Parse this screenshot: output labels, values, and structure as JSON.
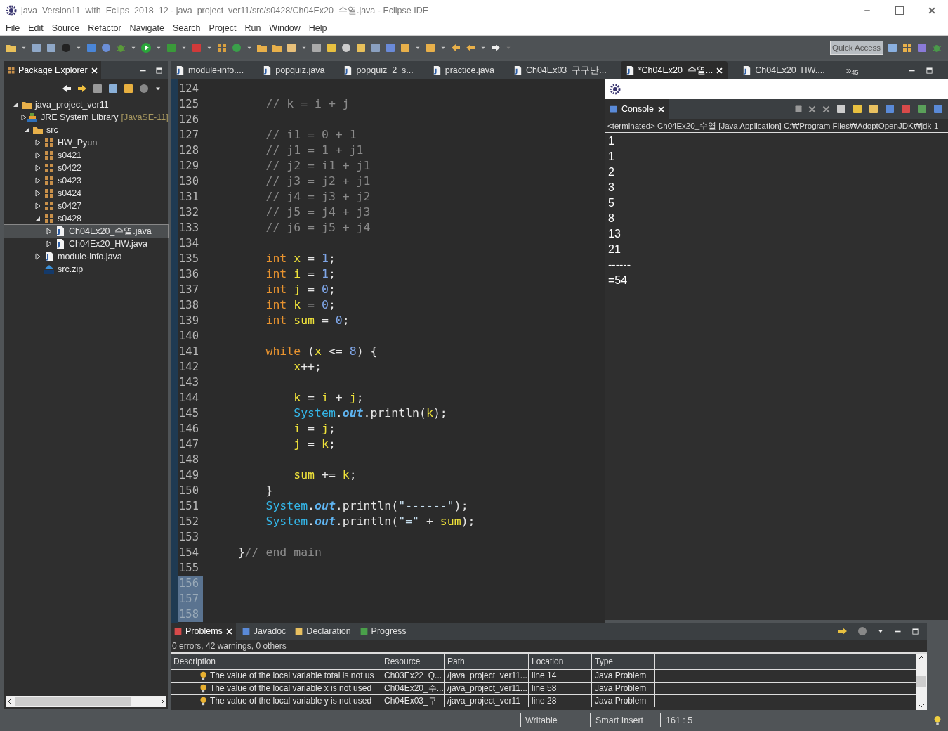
{
  "window": {
    "title": "java_Version11_with_Eclips_2018_12 - java_project_ver11/src/s0428/Ch04Ex20_수열.java - Eclipse IDE"
  },
  "menu": [
    "File",
    "Edit",
    "Source",
    "Refactor",
    "Navigate",
    "Search",
    "Project",
    "Run",
    "Window",
    "Help"
  ],
  "quick_access": {
    "placeholder": "Quick Access"
  },
  "package_explorer": {
    "title": "Package Explorer",
    "tree": [
      {
        "label": "java_project_ver11",
        "kind": "project",
        "expanded": true,
        "selected": false,
        "children": [
          {
            "label": "JRE System Library",
            "qualifier": "[JavaSE-11]",
            "kind": "library",
            "expanded": false,
            "selected": false
          },
          {
            "label": "src",
            "kind": "source-folder",
            "expanded": true,
            "selected": false,
            "children": [
              {
                "label": "HW_Pyun",
                "kind": "package",
                "expanded": false,
                "selected": false
              },
              {
                "label": "s0421",
                "kind": "package",
                "expanded": false,
                "selected": false
              },
              {
                "label": "s0422",
                "kind": "package",
                "expanded": false,
                "selected": false
              },
              {
                "label": "s0423",
                "kind": "package",
                "expanded": false,
                "selected": false
              },
              {
                "label": "s0424",
                "kind": "package",
                "expanded": false,
                "selected": false
              },
              {
                "label": "s0427",
                "kind": "package",
                "expanded": false,
                "selected": false
              },
              {
                "label": "s0428",
                "kind": "package",
                "expanded": true,
                "selected": false,
                "children": [
                  {
                    "label": "Ch04Ex20_수열.java",
                    "kind": "java-file",
                    "expanded": false,
                    "selected": true
                  },
                  {
                    "label": "Ch04Ex20_HW.java",
                    "kind": "java-file",
                    "expanded": false,
                    "selected": false
                  }
                ]
              },
              {
                "label": "module-info.java",
                "kind": "java-file",
                "expanded": false,
                "selected": false
              },
              {
                "label": "src.zip",
                "kind": "zip",
                "selected": false
              }
            ]
          }
        ]
      }
    ]
  },
  "editor_tabs": [
    {
      "label": "module-info....",
      "selected": false
    },
    {
      "label": "popquiz.java",
      "selected": false
    },
    {
      "label": "popquiz_2_s...",
      "selected": false
    },
    {
      "label": "practice.java",
      "selected": false
    },
    {
      "label": "Ch04Ex03_구구단...",
      "selected": false
    },
    {
      "label": "*Ch04Ex20_수열...",
      "selected": true
    },
    {
      "label": "Ch04Ex20_HW....",
      "selected": false
    }
  ],
  "overflow": {
    "chevron": "»",
    "count": "45"
  },
  "code_lines": [
    {
      "number": "124",
      "selected": false
    },
    {
      "number": "125",
      "selected": false,
      "tokens": [
        {
          "kind": "comment",
          "text": "        // k = i + j"
        }
      ]
    },
    {
      "number": "126",
      "selected": false
    },
    {
      "number": "127",
      "selected": false,
      "tokens": [
        {
          "kind": "comment",
          "text": "        // i1 = 0 + 1"
        }
      ]
    },
    {
      "number": "128",
      "selected": false,
      "tokens": [
        {
          "kind": "comment",
          "text": "        // j1 = 1 + j1"
        }
      ]
    },
    {
      "number": "129",
      "selected": false,
      "tokens": [
        {
          "kind": "comment",
          "text": "        // j2 = i1 + j1"
        }
      ]
    },
    {
      "number": "130",
      "selected": false,
      "tokens": [
        {
          "kind": "comment",
          "text": "        // j3 = j2 + j1"
        }
      ]
    },
    {
      "number": "131",
      "selected": false,
      "tokens": [
        {
          "kind": "comment",
          "text": "        // j4 = j3 + j2"
        }
      ]
    },
    {
      "number": "132",
      "selected": false,
      "tokens": [
        {
          "kind": "comment",
          "text": "        // j5 = j4 + j3"
        }
      ]
    },
    {
      "number": "133",
      "selected": false,
      "tokens": [
        {
          "kind": "comment",
          "text": "        // j6 = j5 + j4"
        }
      ]
    },
    {
      "number": "134",
      "selected": false
    },
    {
      "number": "135",
      "selected": false,
      "tokens": [
        {
          "kind": "keyword",
          "text": "        int "
        },
        {
          "kind": "variable",
          "text": "x"
        },
        {
          "kind": "plain",
          "text": " = "
        },
        {
          "kind": "number",
          "text": "1"
        },
        {
          "kind": "plain",
          "text": ";"
        }
      ]
    },
    {
      "number": "136",
      "selected": false,
      "tokens": [
        {
          "kind": "keyword",
          "text": "        int "
        },
        {
          "kind": "variable",
          "text": "i"
        },
        {
          "kind": "plain",
          "text": " = "
        },
        {
          "kind": "number",
          "text": "1"
        },
        {
          "kind": "plain",
          "text": ";"
        }
      ]
    },
    {
      "number": "137",
      "selected": false,
      "tokens": [
        {
          "kind": "keyword",
          "text": "        int "
        },
        {
          "kind": "variable",
          "text": "j"
        },
        {
          "kind": "plain",
          "text": " = "
        },
        {
          "kind": "number",
          "text": "0"
        },
        {
          "kind": "plain",
          "text": ";"
        }
      ]
    },
    {
      "number": "138",
      "selected": false,
      "tokens": [
        {
          "kind": "keyword",
          "text": "        int "
        },
        {
          "kind": "variable",
          "text": "k"
        },
        {
          "kind": "plain",
          "text": " = "
        },
        {
          "kind": "number",
          "text": "0"
        },
        {
          "kind": "plain",
          "text": ";"
        }
      ]
    },
    {
      "number": "139",
      "selected": false,
      "tokens": [
        {
          "kind": "keyword",
          "text": "        int "
        },
        {
          "kind": "variable",
          "text": "sum"
        },
        {
          "kind": "plain",
          "text": " = "
        },
        {
          "kind": "number",
          "text": "0"
        },
        {
          "kind": "plain",
          "text": ";"
        }
      ]
    },
    {
      "number": "140",
      "selected": false
    },
    {
      "number": "141",
      "selected": false,
      "tokens": [
        {
          "kind": "keyword",
          "text": "        while"
        },
        {
          "kind": "plain",
          "text": " ("
        },
        {
          "kind": "variable",
          "text": "x"
        },
        {
          "kind": "plain",
          "text": " <= "
        },
        {
          "kind": "number",
          "text": "8"
        },
        {
          "kind": "plain",
          "text": ") {"
        }
      ]
    },
    {
      "number": "142",
      "selected": false,
      "tokens": [
        {
          "kind": "variable",
          "text": "            x"
        },
        {
          "kind": "plain",
          "text": "++;"
        }
      ]
    },
    {
      "number": "143",
      "selected": false
    },
    {
      "number": "144",
      "selected": false,
      "tokens": [
        {
          "kind": "variable",
          "text": "            k"
        },
        {
          "kind": "plain",
          "text": " = "
        },
        {
          "kind": "variable",
          "text": "i"
        },
        {
          "kind": "plain",
          "text": " + "
        },
        {
          "kind": "variable",
          "text": "j"
        },
        {
          "kind": "plain",
          "text": ";"
        }
      ]
    },
    {
      "number": "145",
      "selected": false,
      "tokens": [
        {
          "kind": "type",
          "text": "            System"
        },
        {
          "kind": "plain",
          "text": "."
        },
        {
          "kind": "field",
          "text": "out"
        },
        {
          "kind": "plain",
          "text": ".println("
        },
        {
          "kind": "variable",
          "text": "k"
        },
        {
          "kind": "plain",
          "text": ");"
        }
      ]
    },
    {
      "number": "146",
      "selected": false,
      "tokens": [
        {
          "kind": "variable",
          "text": "            i"
        },
        {
          "kind": "plain",
          "text": " = "
        },
        {
          "kind": "variable",
          "text": "j"
        },
        {
          "kind": "plain",
          "text": ";"
        }
      ]
    },
    {
      "number": "147",
      "selected": false,
      "tokens": [
        {
          "kind": "variable",
          "text": "            j"
        },
        {
          "kind": "plain",
          "text": " = "
        },
        {
          "kind": "variable",
          "text": "k"
        },
        {
          "kind": "plain",
          "text": ";"
        }
      ]
    },
    {
      "number": "148",
      "selected": false
    },
    {
      "number": "149",
      "selected": false,
      "tokens": [
        {
          "kind": "variable",
          "text": "            sum"
        },
        {
          "kind": "plain",
          "text": " += "
        },
        {
          "kind": "variable",
          "text": "k"
        },
        {
          "kind": "plain",
          "text": ";"
        }
      ]
    },
    {
      "number": "150",
      "selected": false,
      "tokens": [
        {
          "kind": "plain",
          "text": "        }"
        }
      ]
    },
    {
      "number": "151",
      "selected": false,
      "tokens": [
        {
          "kind": "type",
          "text": "        System"
        },
        {
          "kind": "plain",
          "text": "."
        },
        {
          "kind": "field",
          "text": "out"
        },
        {
          "kind": "plain",
          "text": ".println("
        },
        {
          "kind": "string",
          "text": "\"------\""
        },
        {
          "kind": "plain",
          "text": ");"
        }
      ]
    },
    {
      "number": "152",
      "selected": false,
      "tokens": [
        {
          "kind": "type",
          "text": "        System"
        },
        {
          "kind": "plain",
          "text": "."
        },
        {
          "kind": "field",
          "text": "out"
        },
        {
          "kind": "plain",
          "text": ".println("
        },
        {
          "kind": "string",
          "text": "\"=\""
        },
        {
          "kind": "plain",
          "text": " + "
        },
        {
          "kind": "variable",
          "text": "sum"
        },
        {
          "kind": "plain",
          "text": ");"
        }
      ]
    },
    {
      "number": "153",
      "selected": false
    },
    {
      "number": "154",
      "selected": false,
      "tokens": [
        {
          "kind": "plain",
          "text": "    }"
        },
        {
          "kind": "comment",
          "text": "// end main"
        }
      ]
    },
    {
      "number": "155",
      "selected": false
    },
    {
      "number": "156",
      "selected": true
    },
    {
      "number": "157",
      "selected": true
    },
    {
      "number": "158",
      "selected": true
    }
  ],
  "console": {
    "title": "Console",
    "header": "<terminated> Ch04Ex20_수열 [Java Application] C:₩Program Files₩AdoptOpenJDK₩jdk-1",
    "output": [
      "1",
      "1",
      "2",
      "3",
      "5",
      "8",
      "13",
      "21",
      "------",
      "=54"
    ]
  },
  "bottom_tabs": [
    {
      "label": "Problems",
      "selected": true
    },
    {
      "label": "Javadoc",
      "selected": false
    },
    {
      "label": "Declaration",
      "selected": false
    },
    {
      "label": "Progress",
      "selected": false
    }
  ],
  "problems": {
    "summary": "0 errors, 42 warnings, 0 others",
    "columns": [
      "Description",
      "Resource",
      "Path",
      "Location",
      "Type"
    ],
    "rows": [
      [
        "The value of the local variable total is not us",
        "Ch03Ex22_Q...",
        "/java_project_ver11...",
        "line 14",
        "Java Problem"
      ],
      [
        "The value of the local variable x is not used",
        "Ch04Ex20_수...",
        "/java_project_ver11...",
        "line 58",
        "Java Problem"
      ],
      [
        "The value of the local variable y is not used",
        "Ch04Ex03_구",
        "/java_project_ver11",
        "line 28",
        "Java Problem"
      ]
    ]
  },
  "status_bar": [
    "Writable",
    "Smart Insert",
    "161 : 5"
  ]
}
